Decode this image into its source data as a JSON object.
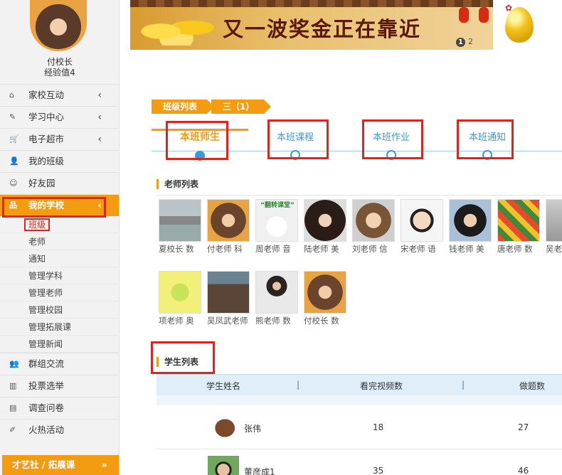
{
  "profile": {
    "name": "付校长",
    "experience": "经验值4"
  },
  "menu": [
    {
      "label": "家校互动",
      "icon": "home-icon",
      "glyph": "⌂",
      "chevron": "‹"
    },
    {
      "label": "学习中心",
      "icon": "edit-icon",
      "glyph": "✎",
      "chevron": "‹"
    },
    {
      "label": "电子超市",
      "icon": "cart-icon",
      "glyph": "🛒",
      "chevron": "‹"
    },
    {
      "label": "我的班级",
      "icon": "user-icon",
      "glyph": "👤",
      "chevron": ""
    },
    {
      "label": "好友园",
      "icon": "smile-icon",
      "glyph": "☺",
      "chevron": ""
    },
    {
      "label": "我的学校",
      "icon": "sitemap-icon",
      "glyph": "品",
      "chevron": "‹"
    }
  ],
  "submenu": [
    "班级",
    "老师",
    "通知",
    "管理学科",
    "管理老师",
    "管理校园",
    "管理拓展课",
    "管理新闻"
  ],
  "menu2": [
    {
      "label": "群组交流",
      "icon": "group-icon",
      "glyph": "👥"
    },
    {
      "label": "投票选举",
      "icon": "bar-chart-icon",
      "glyph": "▥"
    },
    {
      "label": "调查问卷",
      "icon": "file-icon",
      "glyph": "▤"
    },
    {
      "label": "火热活动",
      "icon": "fire-icon",
      "glyph": "✐"
    }
  ],
  "sidebar_bottom": {
    "label": "才艺社 / 拓展课",
    "arrow": "»"
  },
  "banner": {
    "title": "又一波奖金正在靠近",
    "page_current": "1",
    "page_next": "2"
  },
  "breadcrumb": [
    "班级列表",
    "三（1）"
  ],
  "tabs": [
    "本班师生",
    "本班课程",
    "本班作业",
    "本班通知"
  ],
  "teachers_heading": "老师列表",
  "teachers_row1": [
    "夏校长 数",
    "付老师 科",
    "周老师 音",
    "陆老师 美",
    "刘老师 信",
    "宋老师 语",
    "钱老师 美",
    "唐老师 数",
    "吴老"
  ],
  "teachers_row2": [
    "项老师 奥",
    "吴凤武老师",
    "熊老师 数",
    "付校长 数"
  ],
  "teacher_photo_caption": "“翻转课堂”",
  "students_heading": "学生列表",
  "table_headers": {
    "name": "学生姓名",
    "videos": "看完视频数",
    "exercises": "做题数",
    "divider": "|"
  },
  "students": [
    {
      "name": "张伟",
      "videos": "18",
      "exercises": "27"
    },
    {
      "name": "董彦成1",
      "videos": "35",
      "exercises": "46"
    }
  ],
  "colors": {
    "accent": "#f39c12",
    "highlight_box": "#e0241b",
    "tab_blue": "#3a9ad6"
  }
}
